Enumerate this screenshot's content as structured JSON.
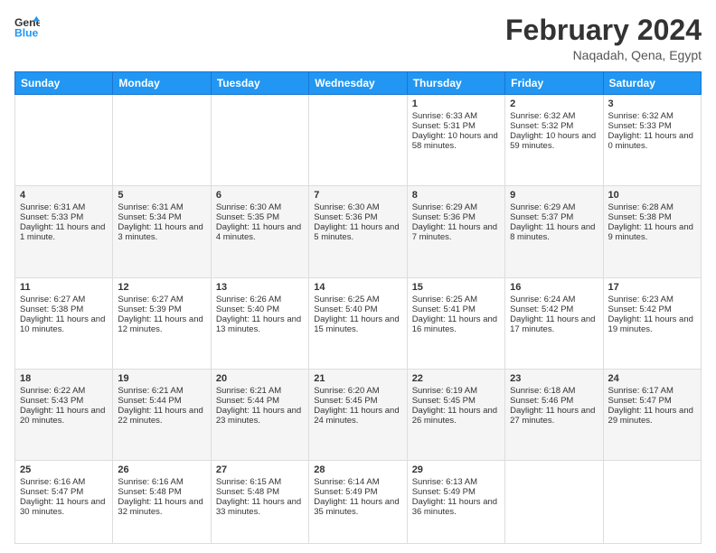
{
  "header": {
    "logo_line1": "General",
    "logo_line2": "Blue",
    "title": "February 2024",
    "location": "Naqadah, Qena, Egypt"
  },
  "days_of_week": [
    "Sunday",
    "Monday",
    "Tuesday",
    "Wednesday",
    "Thursday",
    "Friday",
    "Saturday"
  ],
  "weeks": [
    [
      {
        "day": "",
        "info": ""
      },
      {
        "day": "",
        "info": ""
      },
      {
        "day": "",
        "info": ""
      },
      {
        "day": "",
        "info": ""
      },
      {
        "day": "1",
        "info": "Sunrise: 6:33 AM\nSunset: 5:31 PM\nDaylight: 10 hours and 58 minutes."
      },
      {
        "day": "2",
        "info": "Sunrise: 6:32 AM\nSunset: 5:32 PM\nDaylight: 10 hours and 59 minutes."
      },
      {
        "day": "3",
        "info": "Sunrise: 6:32 AM\nSunset: 5:33 PM\nDaylight: 11 hours and 0 minutes."
      }
    ],
    [
      {
        "day": "4",
        "info": "Sunrise: 6:31 AM\nSunset: 5:33 PM\nDaylight: 11 hours and 1 minute."
      },
      {
        "day": "5",
        "info": "Sunrise: 6:31 AM\nSunset: 5:34 PM\nDaylight: 11 hours and 3 minutes."
      },
      {
        "day": "6",
        "info": "Sunrise: 6:30 AM\nSunset: 5:35 PM\nDaylight: 11 hours and 4 minutes."
      },
      {
        "day": "7",
        "info": "Sunrise: 6:30 AM\nSunset: 5:36 PM\nDaylight: 11 hours and 5 minutes."
      },
      {
        "day": "8",
        "info": "Sunrise: 6:29 AM\nSunset: 5:36 PM\nDaylight: 11 hours and 7 minutes."
      },
      {
        "day": "9",
        "info": "Sunrise: 6:29 AM\nSunset: 5:37 PM\nDaylight: 11 hours and 8 minutes."
      },
      {
        "day": "10",
        "info": "Sunrise: 6:28 AM\nSunset: 5:38 PM\nDaylight: 11 hours and 9 minutes."
      }
    ],
    [
      {
        "day": "11",
        "info": "Sunrise: 6:27 AM\nSunset: 5:38 PM\nDaylight: 11 hours and 10 minutes."
      },
      {
        "day": "12",
        "info": "Sunrise: 6:27 AM\nSunset: 5:39 PM\nDaylight: 11 hours and 12 minutes."
      },
      {
        "day": "13",
        "info": "Sunrise: 6:26 AM\nSunset: 5:40 PM\nDaylight: 11 hours and 13 minutes."
      },
      {
        "day": "14",
        "info": "Sunrise: 6:25 AM\nSunset: 5:40 PM\nDaylight: 11 hours and 15 minutes."
      },
      {
        "day": "15",
        "info": "Sunrise: 6:25 AM\nSunset: 5:41 PM\nDaylight: 11 hours and 16 minutes."
      },
      {
        "day": "16",
        "info": "Sunrise: 6:24 AM\nSunset: 5:42 PM\nDaylight: 11 hours and 17 minutes."
      },
      {
        "day": "17",
        "info": "Sunrise: 6:23 AM\nSunset: 5:42 PM\nDaylight: 11 hours and 19 minutes."
      }
    ],
    [
      {
        "day": "18",
        "info": "Sunrise: 6:22 AM\nSunset: 5:43 PM\nDaylight: 11 hours and 20 minutes."
      },
      {
        "day": "19",
        "info": "Sunrise: 6:21 AM\nSunset: 5:44 PM\nDaylight: 11 hours and 22 minutes."
      },
      {
        "day": "20",
        "info": "Sunrise: 6:21 AM\nSunset: 5:44 PM\nDaylight: 11 hours and 23 minutes."
      },
      {
        "day": "21",
        "info": "Sunrise: 6:20 AM\nSunset: 5:45 PM\nDaylight: 11 hours and 24 minutes."
      },
      {
        "day": "22",
        "info": "Sunrise: 6:19 AM\nSunset: 5:45 PM\nDaylight: 11 hours and 26 minutes."
      },
      {
        "day": "23",
        "info": "Sunrise: 6:18 AM\nSunset: 5:46 PM\nDaylight: 11 hours and 27 minutes."
      },
      {
        "day": "24",
        "info": "Sunrise: 6:17 AM\nSunset: 5:47 PM\nDaylight: 11 hours and 29 minutes."
      }
    ],
    [
      {
        "day": "25",
        "info": "Sunrise: 6:16 AM\nSunset: 5:47 PM\nDaylight: 11 hours and 30 minutes."
      },
      {
        "day": "26",
        "info": "Sunrise: 6:16 AM\nSunset: 5:48 PM\nDaylight: 11 hours and 32 minutes."
      },
      {
        "day": "27",
        "info": "Sunrise: 6:15 AM\nSunset: 5:48 PM\nDaylight: 11 hours and 33 minutes."
      },
      {
        "day": "28",
        "info": "Sunrise: 6:14 AM\nSunset: 5:49 PM\nDaylight: 11 hours and 35 minutes."
      },
      {
        "day": "29",
        "info": "Sunrise: 6:13 AM\nSunset: 5:49 PM\nDaylight: 11 hours and 36 minutes."
      },
      {
        "day": "",
        "info": ""
      },
      {
        "day": "",
        "info": ""
      }
    ]
  ]
}
